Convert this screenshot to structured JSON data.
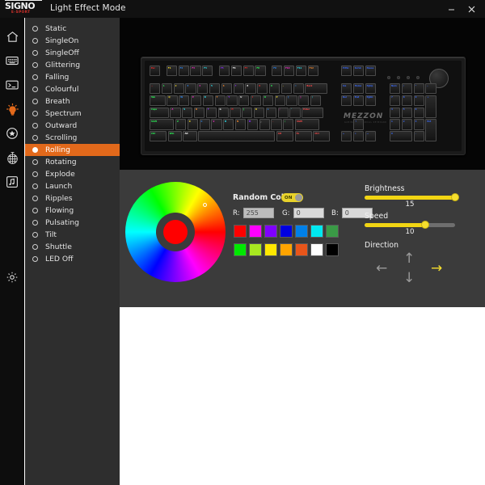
{
  "titlebar": {
    "logo_main": "SIGNO",
    "logo_sub": "E-SPORT",
    "title": "Light Effect Mode",
    "minimize_icon": "minimize-icon",
    "close_icon": "close-icon"
  },
  "rail": {
    "items": [
      {
        "name": "home-icon",
        "label": "Home",
        "active": false
      },
      {
        "name": "keyboard-icon",
        "label": "Keyboard",
        "active": false
      },
      {
        "name": "macro-icon",
        "label": "Macro",
        "active": false
      },
      {
        "name": "lightbulb-icon",
        "label": "Lighting",
        "active": true
      },
      {
        "name": "game-mode-icon",
        "label": "Game Mode",
        "active": false
      },
      {
        "name": "disco-ball-icon",
        "label": "Effects",
        "active": false
      },
      {
        "name": "music-note-icon",
        "label": "Music",
        "active": false
      },
      {
        "name": "gear-icon",
        "label": "Settings",
        "active": false
      }
    ]
  },
  "effects": {
    "selected": "Rolling",
    "items": [
      {
        "label": "Static"
      },
      {
        "label": "SingleOn"
      },
      {
        "label": "SingleOff"
      },
      {
        "label": "Glittering"
      },
      {
        "label": "Falling"
      },
      {
        "label": "Colourful"
      },
      {
        "label": "Breath"
      },
      {
        "label": "Spectrum"
      },
      {
        "label": "Outward"
      },
      {
        "label": "Scrolling"
      },
      {
        "label": "Rolling"
      },
      {
        "label": "Rotating"
      },
      {
        "label": "Explode"
      },
      {
        "label": "Launch"
      },
      {
        "label": "Ripples"
      },
      {
        "label": "Flowing"
      },
      {
        "label": "Pulsating"
      },
      {
        "label": "Tilt"
      },
      {
        "label": "Shuttle"
      },
      {
        "label": "LED Off"
      }
    ]
  },
  "keyboard": {
    "brand": "MEZZON",
    "brand_sub": "GAMING MECHANICAL KEYBOARD",
    "knob_label": "volume-knob"
  },
  "color_picker": {
    "wheel_name": "hue-color-wheel",
    "selected_color": "#ff0000",
    "random_color_label": "Random Color",
    "random_color_state": "ON",
    "r_label": "R:",
    "g_label": "G:",
    "b_label": "B:",
    "r_value": "255",
    "g_value": "0",
    "b_value": "0",
    "swatches": [
      "#ff0000",
      "#ff00ff",
      "#8000ff",
      "#0000e0",
      "#0080e8",
      "#00e8f0",
      "#3a9a46",
      "#00e800",
      "#a8e820",
      "#ffe800",
      "#ffa400",
      "#e8551a",
      "#ffffff",
      "#000000"
    ]
  },
  "controls": {
    "brightness_label": "Brightness",
    "brightness_value": "15",
    "brightness_percent": 100,
    "speed_label": "Speed",
    "speed_value": "10",
    "speed_percent": 67,
    "direction_label": "Direction",
    "direction_selected": "right",
    "arrows": {
      "up": "↑",
      "down": "↓",
      "left": "←",
      "right": "→"
    }
  }
}
